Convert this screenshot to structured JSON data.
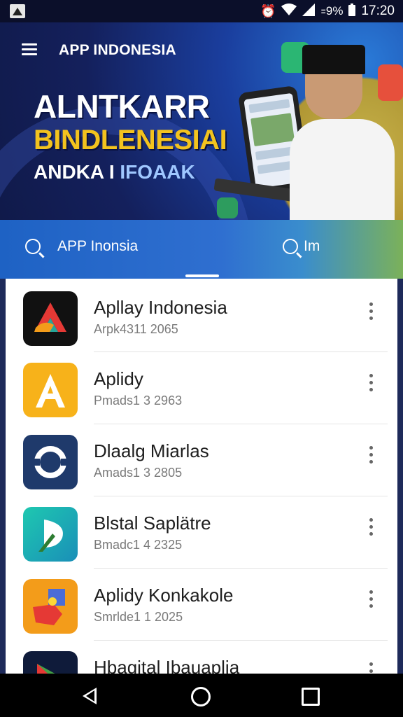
{
  "status_bar": {
    "battery_text": "꞊9%",
    "time": "17:20"
  },
  "appbar": {
    "title": "APP INDONESIA"
  },
  "hero": {
    "line1": "ALNTKARR",
    "line2": "BINDLENESIAI",
    "line3a": "ANDKA I",
    "line3b": "IFOAAK"
  },
  "search": {
    "left_text": "APP Inonsia",
    "right_text": "Im"
  },
  "apps": [
    {
      "title": "Apllay Indonesia",
      "subtitle": "Arpk4311 2065",
      "icon": "app-logo-triangle-icon",
      "colors": [
        "#111111",
        "#e53935",
        "#26a69a"
      ]
    },
    {
      "title": "Aplidy",
      "subtitle": "Pmads1 3 2963",
      "icon": "app-logo-letter-a-icon",
      "colors": [
        "#f7b21a",
        "#ffffff"
      ]
    },
    {
      "title": "Dlaalg Miarlas",
      "subtitle": "Amads1 3 2805",
      "icon": "app-logo-ring-icon",
      "colors": [
        "#1f3a6b",
        "#ffffff"
      ]
    },
    {
      "title": "Blstal Saplätre",
      "subtitle": "Bmadc1 4 2325",
      "icon": "app-logo-leaf-icon",
      "colors": [
        "#21b3b0",
        "#ffffff"
      ]
    },
    {
      "title": "Aplidy Konkakole",
      "subtitle": "Smrlde1 1 2025",
      "icon": "app-logo-puzzle-icon",
      "colors": [
        "#f39c1a",
        "#e53935",
        "#4b6cd6"
      ]
    },
    {
      "title": "Hbagital Ibauaplia",
      "subtitle": "",
      "icon": "app-logo-play-icon",
      "colors": [
        "#0f1b3a",
        "#e53935",
        "#43a047"
      ]
    }
  ],
  "colors": {
    "accent_yellow": "#f3c31e",
    "search_blue": "#1e62c4"
  }
}
